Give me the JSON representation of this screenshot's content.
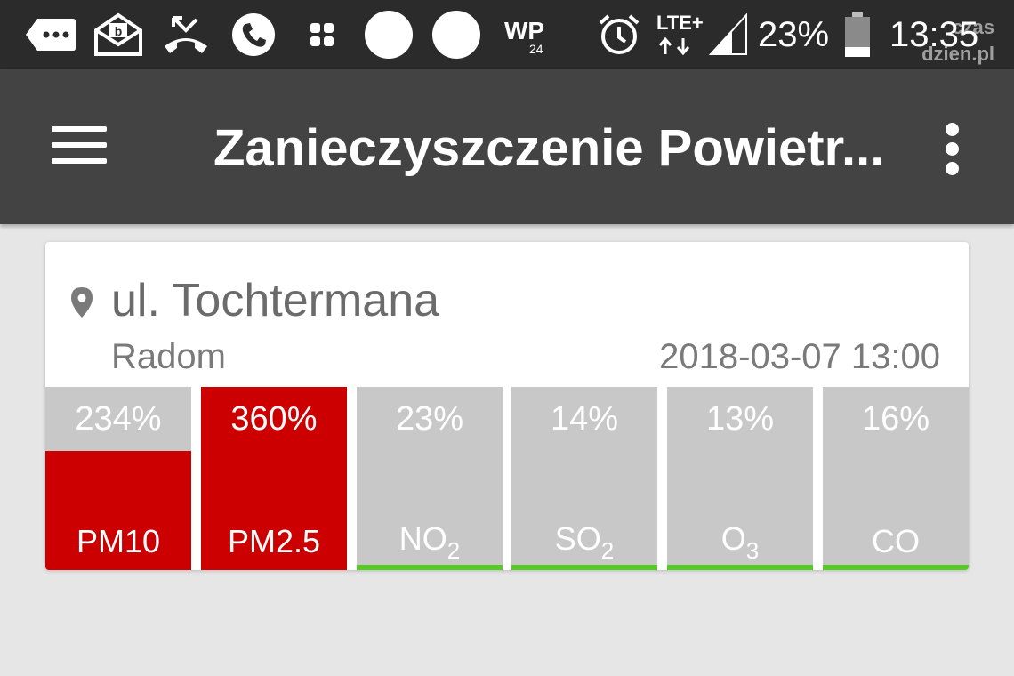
{
  "status_bar": {
    "network": "LTE+",
    "battery": "23%",
    "time": "13:35",
    "watermark_top": "czas",
    "watermark_bottom": "dzien.pl",
    "icons": [
      "message-icon",
      "mail-icon",
      "missed-call-icon",
      "phone-icon",
      "apps-icon",
      "circle-icon",
      "circle-icon",
      "wp-app-icon",
      "alarm-icon",
      "signal-icon",
      "battery-icon"
    ],
    "wp_label": "WP",
    "wp_sub": "24"
  },
  "app_bar": {
    "title": "Zanieczyszczenie Powietr..."
  },
  "station": {
    "street": "ul. Tochtermana",
    "city": "Radom",
    "datetime": "2018-03-07 13:00"
  },
  "pollutants": [
    {
      "name": "PM10",
      "sub": "",
      "percent_label": "234%",
      "level": 2.34,
      "fill_color": "#cc0000"
    },
    {
      "name": "PM2.5",
      "sub": "",
      "percent_label": "360%",
      "level": 3.6,
      "fill_color": "#cc0000"
    },
    {
      "name": "NO",
      "sub": "2",
      "percent_label": "23%",
      "level": 0.23,
      "fill_color": "#55cc22"
    },
    {
      "name": "SO",
      "sub": "2",
      "percent_label": "14%",
      "level": 0.14,
      "fill_color": "#55cc22"
    },
    {
      "name": "O",
      "sub": "3",
      "percent_label": "13%",
      "level": 0.13,
      "fill_color": "#55cc22"
    },
    {
      "name": "CO",
      "sub": "",
      "percent_label": "16%",
      "level": 0.16,
      "fill_color": "#55cc22"
    }
  ],
  "colors": {
    "status_bar_bg": "#2b2b2b",
    "app_bar_bg": "#434343",
    "danger": "#cc0000",
    "good": "#55cc22",
    "tile_bg": "#c8c8c8",
    "page_bg": "#e6e6e6"
  }
}
